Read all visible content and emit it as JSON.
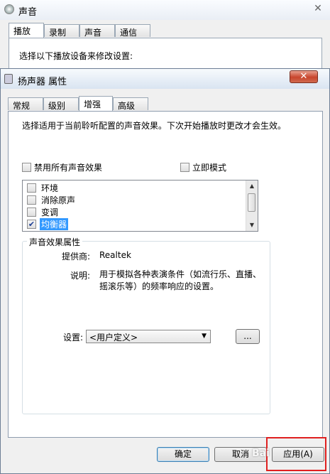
{
  "background_window": {
    "title": "声音",
    "tabs": [
      "播放",
      "录制",
      "声音",
      "通信"
    ],
    "instruction": "选择以下播放设备来修改设置:"
  },
  "dialog": {
    "title": "扬声器 属性",
    "close_label": "✕",
    "tabs": [
      "常规",
      "级别",
      "增强",
      "高级"
    ],
    "active_tab": "增强",
    "description": "选择适用于当前聆听配置的声音效果。下次开始播放时更改才会生效。",
    "disable_all_label": "禁用所有声音效果",
    "immediate_mode_label": "立即模式",
    "effects": [
      {
        "label": "环境",
        "checked": false
      },
      {
        "label": "消除原声",
        "checked": false
      },
      {
        "label": "变调",
        "checked": false
      },
      {
        "label": "均衡器",
        "checked": true,
        "selected": true
      }
    ],
    "group": {
      "title": "声音效果属性",
      "provider_label": "提供商:",
      "provider_value": "Realtek",
      "desc_label": "说明:",
      "desc_value": "用于模拟各种表演条件（如流行乐、直播、摇滚乐等）的频率响应的设置。",
      "settings_label": "设置:",
      "settings_value": "<用户定义>",
      "more_button": "..."
    },
    "buttons": {
      "ok": "确定",
      "cancel": "取消",
      "apply": "应用(A)"
    }
  },
  "watermark": "Bai"
}
